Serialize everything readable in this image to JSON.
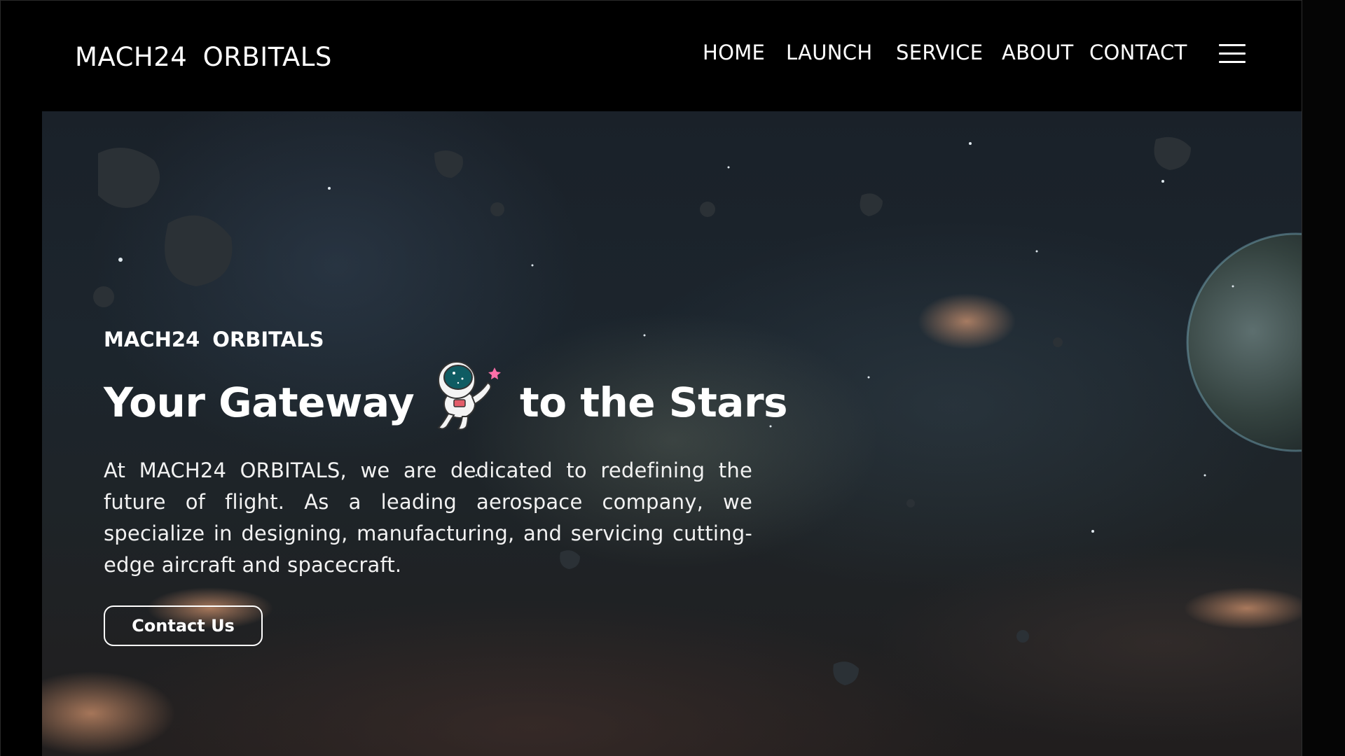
{
  "navbar": {
    "brand": "MACH24  ORBITALS",
    "links": [
      {
        "label": "HOME"
      },
      {
        "label": "LAUNCH"
      },
      {
        "label": "SERVICE"
      },
      {
        "label": "ABOUT"
      },
      {
        "label": "CONTACT"
      }
    ],
    "menu_icon": "hamburger-menu-icon"
  },
  "hero": {
    "eyebrow": "MACH24  ORBITALS",
    "headline_before": "Your Gateway",
    "headline_after": "to the Stars",
    "headline_icon": "astronaut-icon",
    "description": "At MACH24 ORBITALS, we are dedicated to redefining the future of flight. As a leading aerospace company, we specialize in designing, manufacturing, and servicing cutting-edge aircraft and spacecraft.",
    "cta_label": "Contact Us"
  },
  "colors": {
    "background": "#000000",
    "text": "#ffffff",
    "astronaut_visor": "#0f5c63",
    "star_accent": "#ff6fa8"
  }
}
